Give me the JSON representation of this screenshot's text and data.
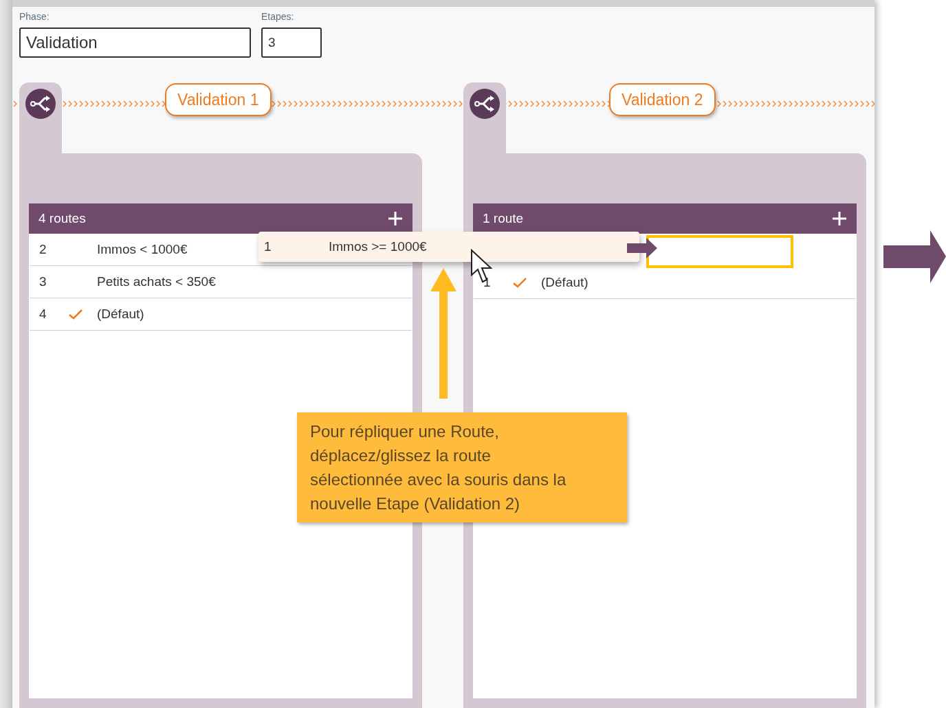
{
  "fields": [
    {
      "label": "Phase:",
      "value": "Validation",
      "kind": "wide"
    },
    {
      "label": "Etapes:",
      "value": "3",
      "kind": "narrow"
    }
  ],
  "steps": [
    {
      "title": "Validation 1",
      "count": "4 routes",
      "drop_target": false,
      "routes": [
        {
          "number": "2",
          "default": false,
          "label": "Immos < 1000€"
        },
        {
          "number": "3",
          "default": false,
          "label": "Petits achats < 350€"
        },
        {
          "number": "4",
          "default": true,
          "label": "(Défaut)"
        }
      ]
    },
    {
      "title": "Validation 2",
      "count": "1 route",
      "drop_target": true,
      "routes": [
        {
          "number": "1",
          "default": true,
          "label": "(Défaut)"
        }
      ]
    }
  ],
  "dragged_route": {
    "number": "1",
    "label": "Immos >= 1000€"
  },
  "hint": "Pour répliquer une Route,\ndéplacez/glissez la route\nsélectionnée avec la souris dans la\nnouvelle Etape (Validation 2)"
}
